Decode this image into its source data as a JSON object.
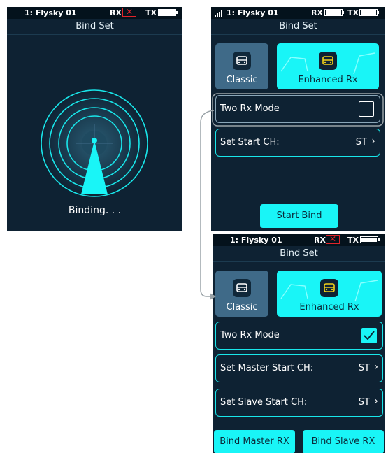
{
  "screen1": {
    "status": {
      "model": "1: Flysky  01",
      "rx": "RX",
      "tx": "TX"
    },
    "title": "Bind Set",
    "binding_text": "Binding. . ."
  },
  "screen2": {
    "status": {
      "model": "1: Flysky  01",
      "rx": "RX",
      "tx": "TX"
    },
    "title": "Bind Set",
    "mode_classic": "Classic",
    "mode_enhanced": "Enhanced Rx",
    "two_rx_mode": {
      "label": "Two Rx Mode",
      "checked": false
    },
    "set_start": {
      "label": "Set Start CH:",
      "value": "ST"
    },
    "start_bind": "Start Bind"
  },
  "screen3": {
    "status": {
      "model": "1: Flysky  01",
      "rx": "RX",
      "tx": "TX"
    },
    "title": "Bind Set",
    "mode_classic": "Classic",
    "mode_enhanced": "Enhanced Rx",
    "two_rx_mode": {
      "label": "Two Rx Mode",
      "checked": true
    },
    "set_master": {
      "label": "Set Master Start CH:",
      "value": "ST"
    },
    "set_slave": {
      "label": "Set Slave Start CH:",
      "value": "ST"
    },
    "bind_master": "Bind Master RX",
    "bind_slave": "Bind Slave RX"
  },
  "colors": {
    "accent": "#19f5f7",
    "background": "#0e2233",
    "classic_tile": "#3f6a88",
    "alert": "#e0242a",
    "car_icon": "#f2d21a"
  },
  "icons": [
    "signal-icon",
    "battery-icon",
    "rx-error-icon",
    "car-icon",
    "chevron-right-icon",
    "check-icon",
    "radar-icon",
    "flow-arrow-icon"
  ]
}
